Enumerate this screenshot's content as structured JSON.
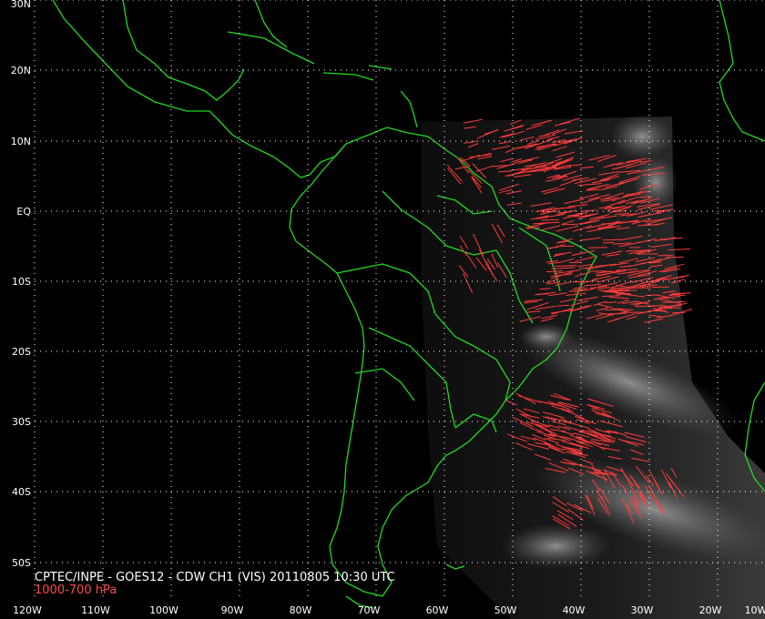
{
  "product": {
    "line1": "CPTEC/INPE - GOES12 - CDW CH1 (VIS) 20110805 10:30 UTC",
    "line2": "1000-700 hPa"
  },
  "colors": {
    "background": "#000000",
    "coastline": "#22d822",
    "wind_vectors": "#ff3b3b",
    "grid": "#ffffff",
    "labels": "#ffffff"
  },
  "axes": {
    "lat_labels": [
      "30N",
      "20N",
      "10N",
      "EQ",
      "10S",
      "20S",
      "30S",
      "40S",
      "50S"
    ],
    "lon_labels": [
      "120W",
      "110W",
      "100W",
      "90W",
      "80W",
      "70W",
      "60W",
      "50W",
      "40W",
      "30W",
      "20W",
      "10W"
    ]
  },
  "map_extent": {
    "lon_min": -120,
    "lon_max": -10,
    "lat_min": -57,
    "lat_max": 30
  },
  "layers": {
    "imagery": "GOES12 visible channel",
    "vectors": "cloud drift winds 1000-700 hPa"
  }
}
